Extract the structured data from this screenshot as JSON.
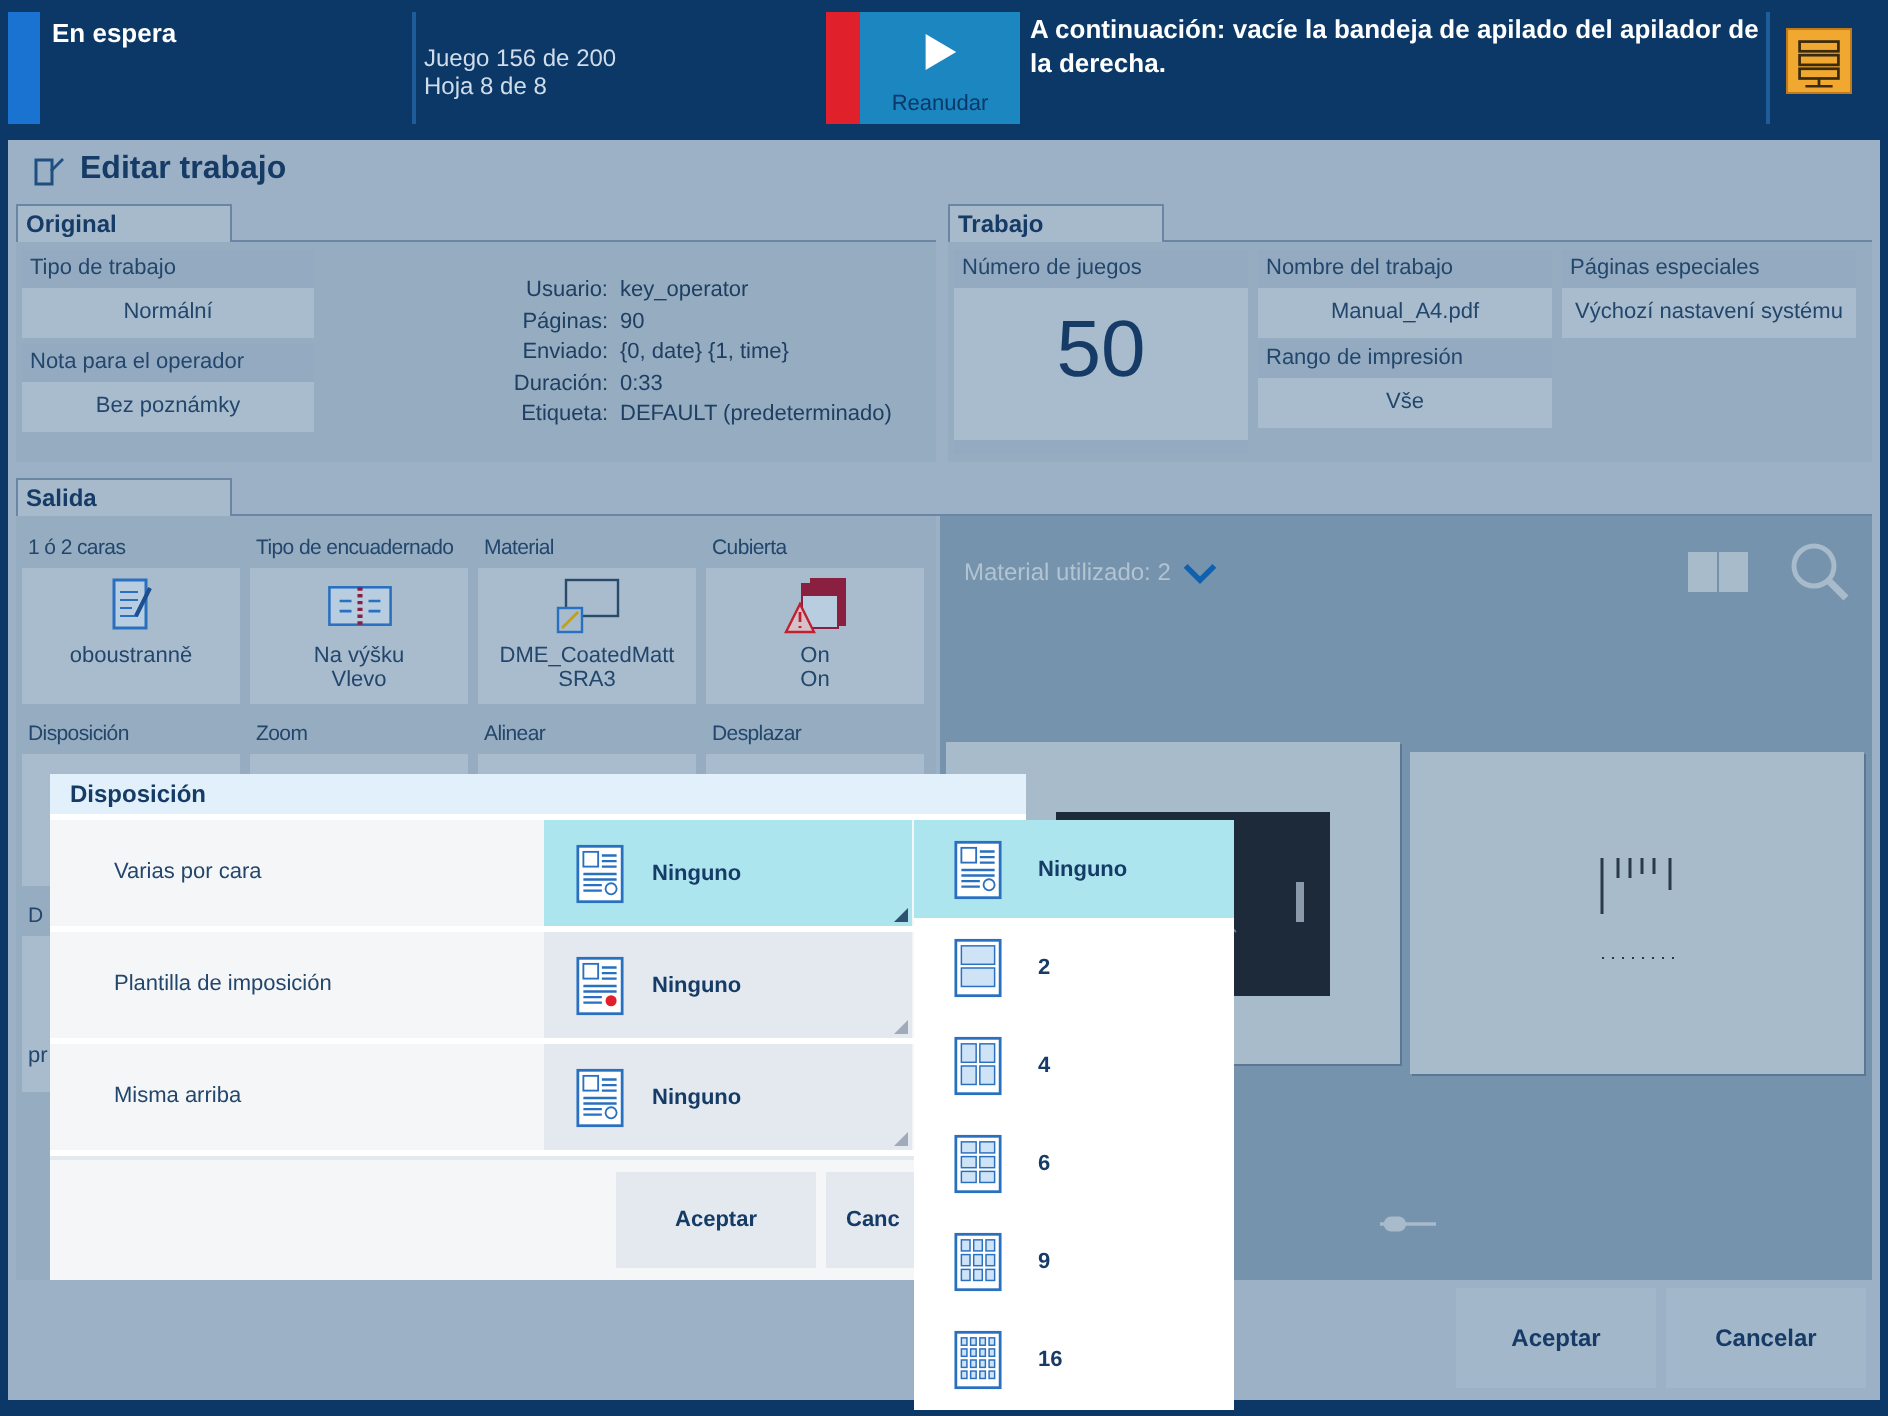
{
  "status_bar": {
    "state": "En espera",
    "progress_lines": [
      "Juego 156 de 200",
      "Hoja 8 de 8"
    ],
    "resume_button": "Reanudar",
    "message": "A continuación: vacíe la bandeja de apilado del apilador de la derecha."
  },
  "window": {
    "title": "Editar trabajo"
  },
  "original": {
    "tab": "Original",
    "fields": [
      {
        "label": "Tipo de trabajo",
        "value": "Normální"
      },
      {
        "label": "Nota para el operador",
        "value": "Bez poznámky"
      }
    ],
    "details": [
      {
        "label": "Usuario:",
        "value": "key_operator"
      },
      {
        "label": "Páginas:",
        "value": "90"
      },
      {
        "label": "Enviado:",
        "value": "{0, date} {1, time}"
      },
      {
        "label": "Duración:",
        "value": "0:33"
      },
      {
        "label": "Etiqueta:",
        "value": "DEFAULT (predeterminado)"
      }
    ]
  },
  "trabajo": {
    "tab": "Trabajo",
    "copies": {
      "label": "Número de juegos",
      "value": "50"
    },
    "columns": [
      [
        {
          "label": "Nombre del trabajo",
          "value": "Manual_A4.pdf"
        },
        {
          "label": "Rango de impresión",
          "value": "Vše"
        }
      ],
      [
        {
          "label": "Páginas especiales",
          "value": "Výchozí nastavení systému"
        }
      ]
    ]
  },
  "salida": {
    "tab": "Salida",
    "tiles": [
      {
        "label": "1 ó 2 caras",
        "kind": "duplex",
        "lines": [
          "oboustranně"
        ]
      },
      {
        "label": "Tipo de encuadernado",
        "kind": "binding",
        "lines": [
          "Na výšku",
          "Vlevo"
        ]
      },
      {
        "label": "Material",
        "kind": "media",
        "lines": [
          "DME_CoatedMatt",
          "SRA3"
        ]
      },
      {
        "label": "Cubierta",
        "kind": "cover",
        "lines": [
          "On",
          "On"
        ]
      }
    ],
    "row2_labels": [
      "Disposición",
      "Zoom",
      "Alinear",
      "Desplazar"
    ],
    "row3": {
      "label": "D",
      "value": "pr"
    }
  },
  "preview": {
    "media_label": "Material utilizado: 2"
  },
  "dialog": {
    "title": "Disposición",
    "rows": [
      {
        "label": "Varias por cara",
        "value": "Ninguno",
        "selected": true,
        "kind": "page"
      },
      {
        "label": "Plantilla de imposición",
        "value": "Ninguno",
        "selected": false,
        "kind": "marked"
      },
      {
        "label": "Misma arriba",
        "value": "Ninguno",
        "selected": false,
        "kind": "page"
      }
    ],
    "buttons": [
      "Aceptar",
      "Canc"
    ]
  },
  "dropdown": {
    "options": [
      {
        "label": "Ninguno",
        "selected": true,
        "kind": "none"
      },
      {
        "label": "2",
        "selected": false,
        "kind": "two"
      },
      {
        "label": "4",
        "selected": false,
        "kind": "four"
      },
      {
        "label": "6",
        "selected": false,
        "kind": "six"
      },
      {
        "label": "9",
        "selected": false,
        "kind": "nine"
      },
      {
        "label": "16",
        "selected": false,
        "kind": "sixteen"
      }
    ]
  },
  "footer": {
    "buttons": [
      "Aceptar",
      "Cancelar"
    ]
  }
}
